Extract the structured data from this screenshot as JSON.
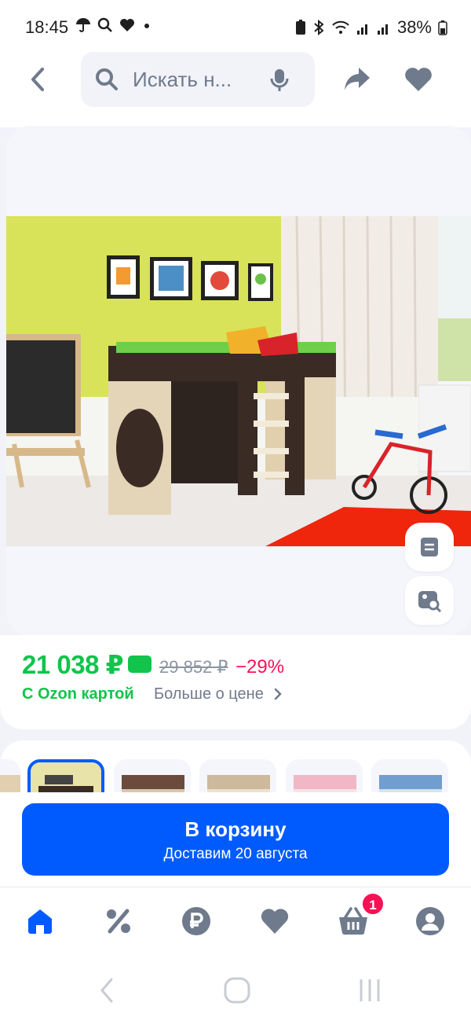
{
  "status_bar": {
    "time": "18:45",
    "battery": "38%"
  },
  "header": {
    "search_placeholder": "Искать н..."
  },
  "product": {
    "price": "21 038 ₽",
    "old_price": "29 852 ₽",
    "discount": "−29%",
    "ozon_card_label": "С Ozon картой",
    "more_price_label": "Больше о цене",
    "variants_count_visible": 6,
    "selected_variant": 1
  },
  "cart_button": {
    "title": "В корзину",
    "subtitle": "Доставим 20 августа"
  },
  "bottom_nav": {
    "cart_badge": "1",
    "items": [
      "home-icon",
      "percent-icon",
      "ruble-icon",
      "heart-icon",
      "basket-icon",
      "profile-icon"
    ]
  },
  "colors": {
    "accent": "#005bff",
    "price_green": "#10c44c",
    "discount_pink": "#f91155",
    "muted": "#8b95a3"
  }
}
